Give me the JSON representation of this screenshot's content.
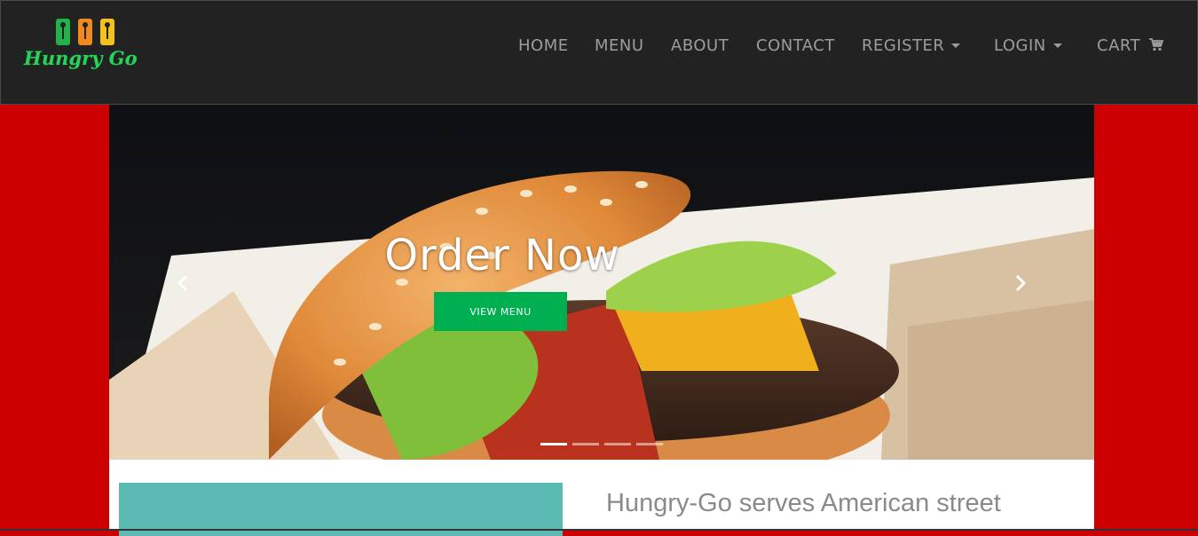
{
  "brand": {
    "logo_text": "Hungry Go"
  },
  "nav": {
    "items": [
      {
        "label": "HOME",
        "dropdown": false
      },
      {
        "label": "MENU",
        "dropdown": false
      },
      {
        "label": "ABOUT",
        "dropdown": false
      },
      {
        "label": "CONTACT",
        "dropdown": false
      },
      {
        "label": "REGISTER",
        "dropdown": true
      },
      {
        "label": "LOGIN",
        "dropdown": true
      },
      {
        "label": "CART",
        "dropdown": false,
        "icon": "shopping-cart-icon"
      }
    ]
  },
  "hero": {
    "title": "Order Now",
    "button_label": "VIEW MENU",
    "prev_icon": "chevron-left-icon",
    "next_icon": "chevron-right-icon",
    "slide_count": 4,
    "active_slide": 1
  },
  "content": {
    "intro": "Hungry-Go serves American street"
  },
  "colors": {
    "page_background": "#cc0000",
    "navbar": "#222222",
    "nav_text": "#9d9d9d",
    "button": "#00b050",
    "brand_green": "#2ad15a",
    "teal_panel": "#5bbab2"
  }
}
